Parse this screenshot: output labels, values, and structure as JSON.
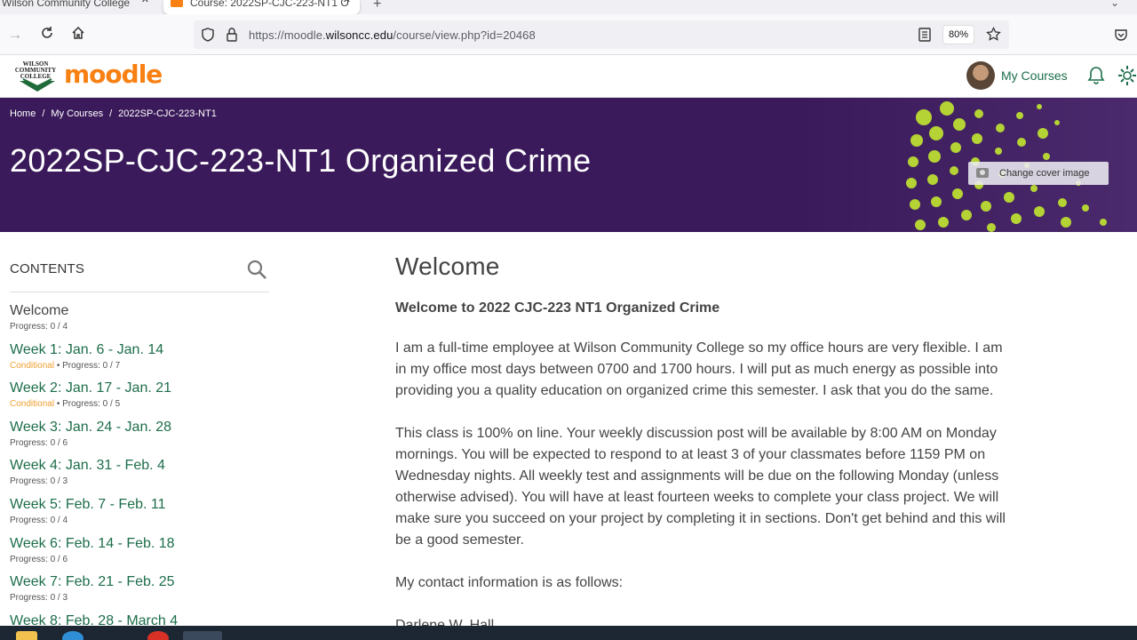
{
  "browser": {
    "tabs": [
      {
        "label": "Wilson Community College",
        "active": false
      },
      {
        "label": "Course: 2022SP-CJC-223-NT1 O",
        "active": true
      }
    ],
    "url": {
      "prefix": "https://moodle.",
      "domain": "wilsoncc.edu",
      "path": "/course/view.php?id=20468"
    },
    "zoom": "80%"
  },
  "header": {
    "logo_text": "WILSON COMMUNITY COLLEGE",
    "moodle_word": "moodle",
    "my_courses": "My Courses"
  },
  "hero": {
    "breadcrumbs": [
      "Home",
      "My Courses",
      "2022SP-CJC-223-NT1"
    ],
    "title": "2022SP-CJC-223-NT1 Organized Crime",
    "cover_button": "Change cover image"
  },
  "sidebar": {
    "heading": "CONTENTS",
    "sections": [
      {
        "title": "Welcome",
        "conditional": "",
        "progress": "Progress: 0 / 4"
      },
      {
        "title": "Week 1: Jan. 6 - Jan. 14",
        "conditional": "Conditional",
        "progress": "Progress: 0 / 7"
      },
      {
        "title": "Week 2: Jan. 17 - Jan. 21",
        "conditional": "Conditional",
        "progress": "Progress: 0 / 5"
      },
      {
        "title": "Week 3: Jan. 24 - Jan. 28",
        "conditional": "",
        "progress": "Progress: 0 / 6"
      },
      {
        "title": "Week 4: Jan. 31 - Feb. 4",
        "conditional": "",
        "progress": "Progress: 0 / 3"
      },
      {
        "title": "Week 5: Feb. 7 - Feb. 11",
        "conditional": "",
        "progress": "Progress: 0 / 4"
      },
      {
        "title": "Week 6: Feb. 14 - Feb. 18",
        "conditional": "",
        "progress": "Progress: 0 / 6"
      },
      {
        "title": "Week 7: Feb. 21 - Feb. 25",
        "conditional": "",
        "progress": "Progress: 0 / 3"
      },
      {
        "title": "Week 8: Feb. 28 - March 4",
        "conditional": "",
        "progress": ""
      }
    ]
  },
  "main": {
    "heading": "Welcome",
    "lead": "Welcome to 2022 CJC-223 NT1 Organized Crime",
    "paragraphs": [
      "I am a full-time employee at Wilson Community College so my office hours are very flexible.  I am in my office most days between 0700 and 1700 hours.  I will put as much energy as possible into providing you a quality education on organized crime this semester. I ask that you do the same.",
      "This class is 100% on line.  Your weekly discussion post will be available by 8:00 AM on Monday mornings.  You will be expected to respond to at least 3 of your classmates before 1159 PM on Wednesday nights.  All weekly test and assignments will be due on the following Monday (unless otherwise advised).  You will have at least fourteen weeks to complete your class project.  We will make sure you succeed on your project by completing it in sections.  Don't get behind and this will be a good semester.",
      "My contact information is as follows:",
      "Darlene W. Hall"
    ]
  },
  "colors": {
    "hero_bg": "#3a1a5a",
    "link_green": "#1d6e4a",
    "moodle_orange": "#f98012",
    "conditional_orange": "#f0a030",
    "dots_green": "#b5d334"
  }
}
